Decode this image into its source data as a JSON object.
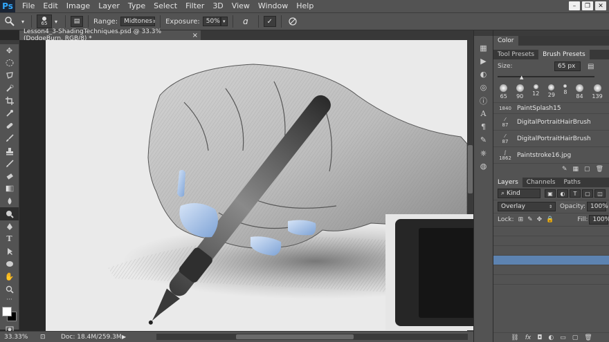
{
  "app": {
    "logo": "Ps",
    "menu": [
      "File",
      "Edit",
      "Image",
      "Layer",
      "Type",
      "Select",
      "Filter",
      "3D",
      "View",
      "Window",
      "Help"
    ]
  },
  "window_controls": {
    "minimize": "–",
    "restore": "❐",
    "close": "✕"
  },
  "options_bar": {
    "brush_size": "65",
    "range_label": "Range:",
    "range_value": "Midtones",
    "exposure_label": "Exposure:",
    "exposure_value": "50%"
  },
  "document": {
    "tab_title": "Lesson4_3-ShadingTechniques.psd @ 33.3% (DodgeBurn, RGB/8) *",
    "close": "×"
  },
  "status_bar": {
    "zoom": "33.33%",
    "doc_info": "Doc: 18.4M/259.3M"
  },
  "panels": {
    "color_tab": "Color",
    "tool_presets_tab": "Tool Presets",
    "brush_presets_tab": "Brush Presets",
    "size_label": "Size:",
    "size_value": "65 px",
    "brush_sizes": [
      "65",
      "90",
      "12",
      "29",
      "8",
      "84",
      "139"
    ],
    "brush_list": [
      {
        "size": "1840",
        "name": "PaintSplash15"
      },
      {
        "size": "87",
        "name": "DigitalPortraitHairBrush"
      },
      {
        "size": "87",
        "name": "DigitalPortraitHairBrush"
      },
      {
        "size": "1862",
        "name": "Paintstroke16.jpg"
      }
    ],
    "layers_tab": "Layers",
    "channels_tab": "Channels",
    "paths_tab": "Paths",
    "kind_label": "Kind",
    "blend_mode": "Overlay",
    "opacity_label": "Opacity:",
    "opacity_value": "100%",
    "lock_label": "Lock:",
    "fill_label": "Fill:",
    "fill_value": "100%"
  },
  "colors": {
    "chrome": "#535353",
    "dark": "#282828",
    "canvas": "#eaeaea",
    "accent": "#31a8ff",
    "fg_color": "#ffffff",
    "bg_color": "#000000"
  },
  "icons": {
    "tools": [
      "move-icon",
      "marquee-icon",
      "lasso-icon",
      "quick-select-icon",
      "crop-icon",
      "eyedropper-icon",
      "spot-heal-icon",
      "brush-icon",
      "clone-stamp-icon",
      "history-brush-icon",
      "eraser-icon",
      "gradient-icon",
      "blur-icon",
      "dodge-icon",
      "pen-icon",
      "type-icon",
      "path-select-icon",
      "shape-icon",
      "hand-icon",
      "zoom-icon"
    ]
  }
}
